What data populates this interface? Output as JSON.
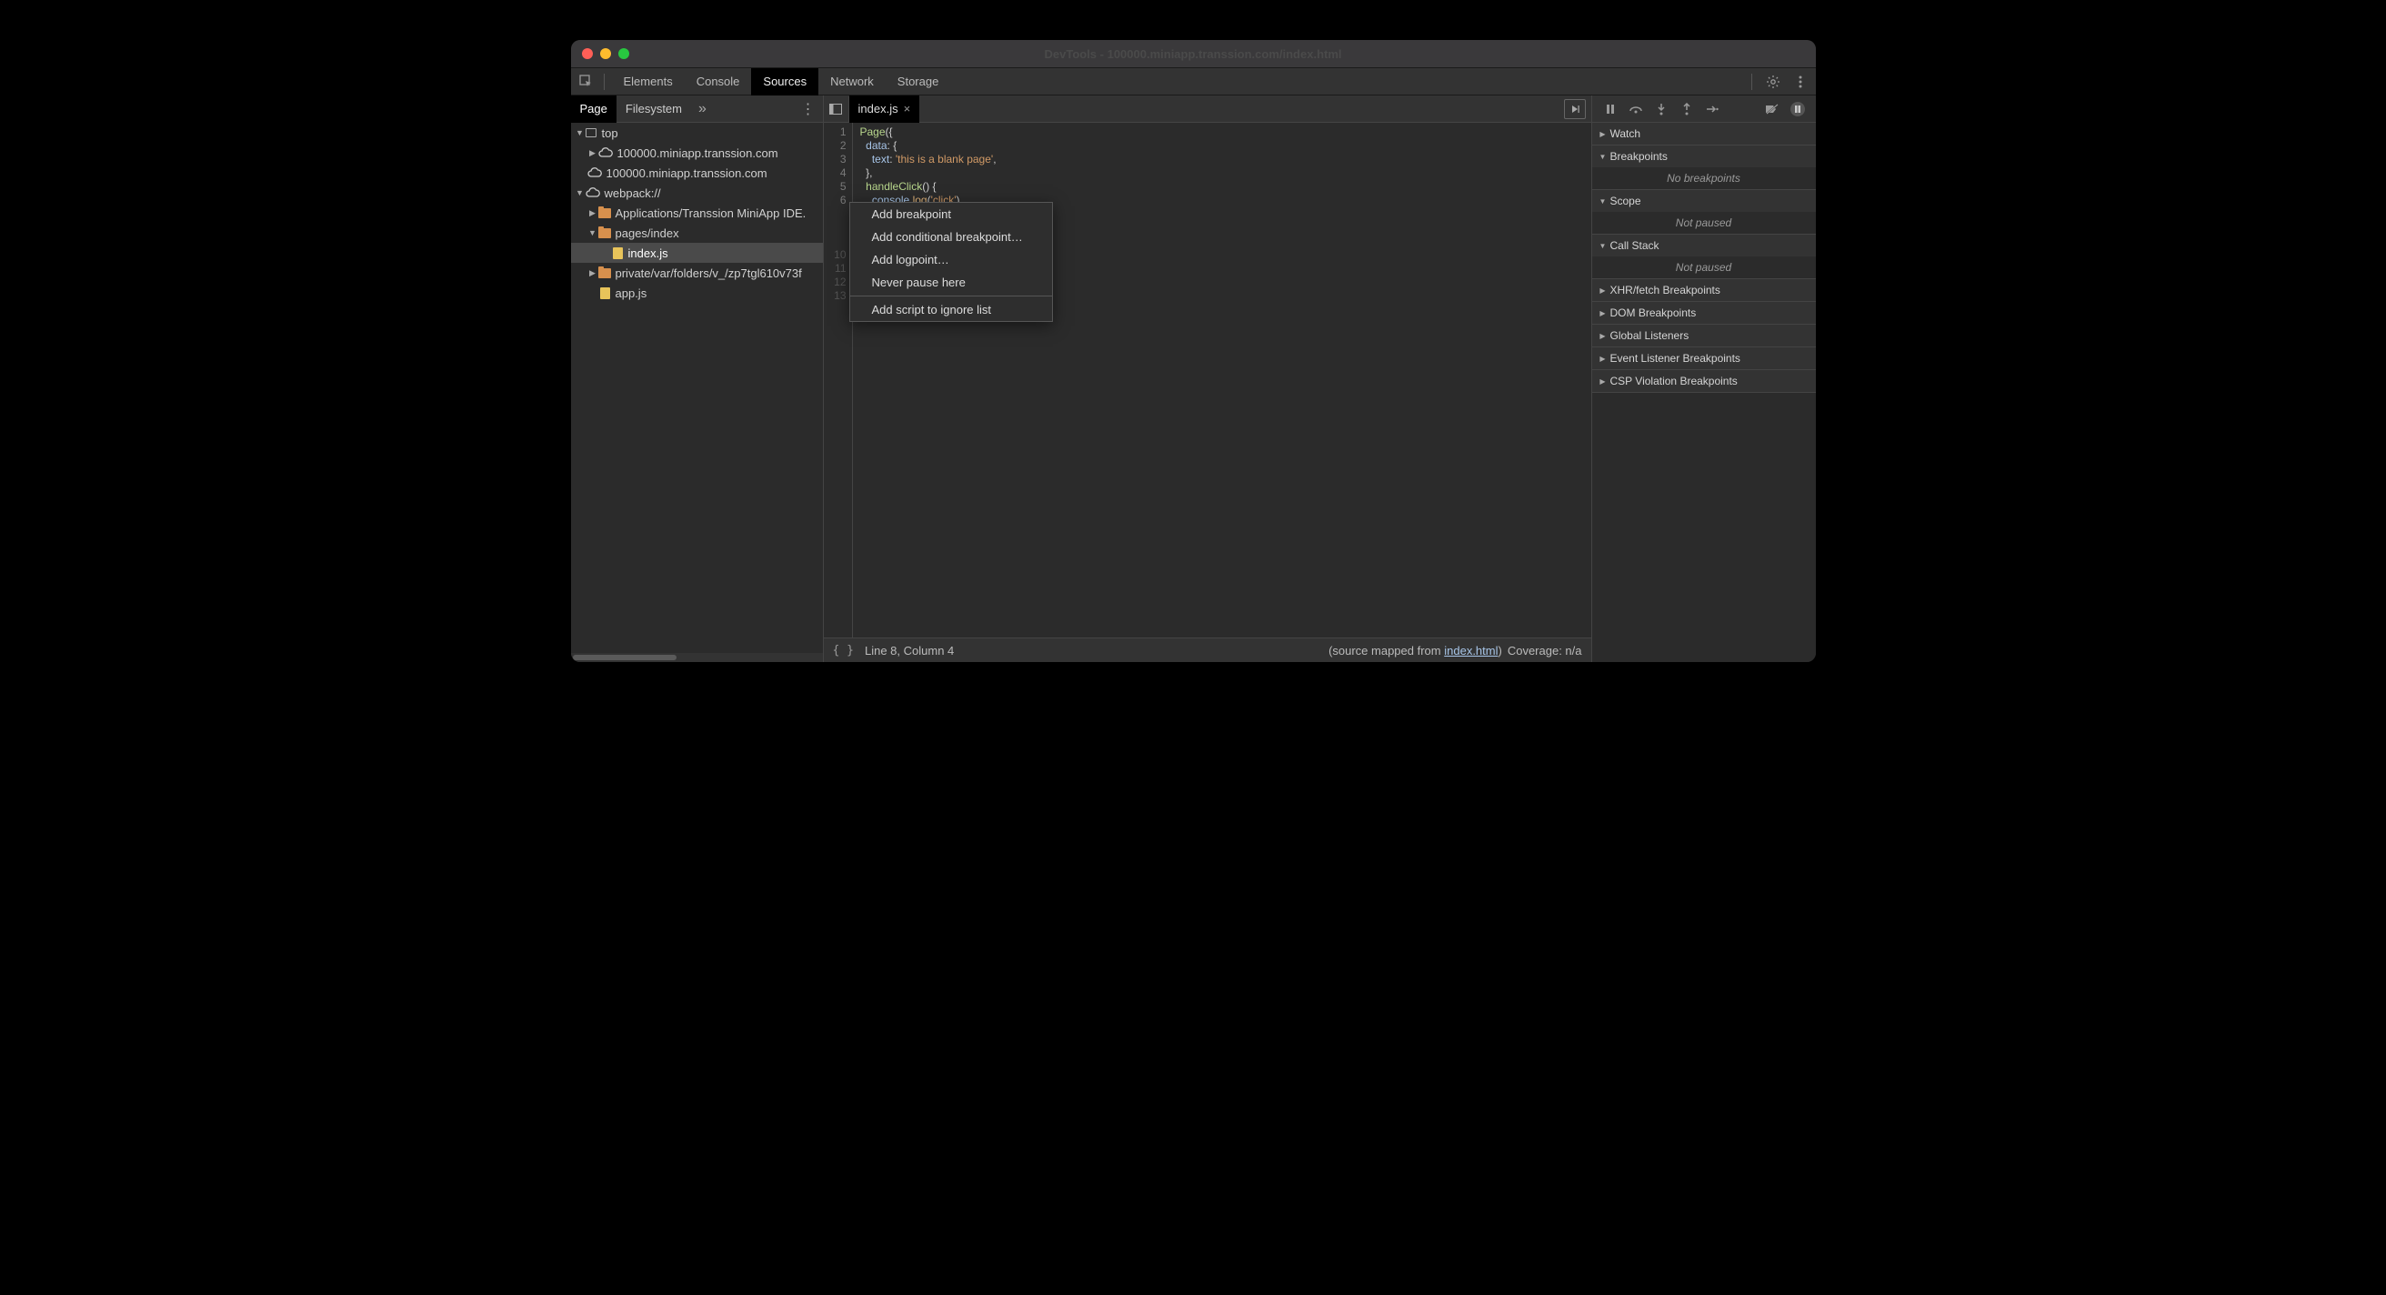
{
  "window_title": "DevTools - 100000.miniapp.transsion.com/index.html",
  "top_tabs": {
    "elements": "Elements",
    "console": "Console",
    "sources": "Sources",
    "network": "Network",
    "storage": "Storage"
  },
  "navigator": {
    "tabs": {
      "page": "Page",
      "filesystem": "Filesystem"
    },
    "tree": {
      "top": "top",
      "domain1": "100000.miniapp.transsion.com",
      "domain2": "100000.miniapp.transsion.com",
      "webpack": "webpack://",
      "apps": "Applications/Transsion MiniApp IDE.",
      "pages_index": "pages/index",
      "index_js": "index.js",
      "private": "private/var/folders/v_/zp7tgl610v73f",
      "app_js": "app.js"
    }
  },
  "editor": {
    "tab_name": "index.js",
    "lines": [
      "1",
      "2",
      "3",
      "4",
      "5",
      "6"
    ],
    "hidden_lines": [
      "10",
      "11",
      "12",
      "13"
    ],
    "code": {
      "l1_a": "Page",
      "l1_b": "({",
      "l2_a": "data",
      "l2_b": ": {",
      "l3_a": "text",
      "l3_b": ": ",
      "l3_c": "'this is a blank page'",
      "l3_d": ",",
      "l4": "},",
      "l5_a": "handleClick",
      "l5_b": "() {",
      "l6_a": "console",
      "l6_b": ".",
      "l6_c": "log",
      "l6_d": "(",
      "l6_e": "'click'",
      "l6_f": ")"
    }
  },
  "context_menu": {
    "add_bp": "Add breakpoint",
    "add_cond": "Add conditional breakpoint…",
    "add_log": "Add logpoint…",
    "never": "Never pause here",
    "ignore": "Add script to ignore list"
  },
  "status": {
    "line_col": "Line 8, Column 4",
    "source_prefix": "(source mapped from ",
    "source_link": "index.html",
    "source_suffix": ")",
    "coverage": "Coverage: n/a"
  },
  "sidebar": {
    "watch": "Watch",
    "breakpoints": "Breakpoints",
    "no_bp": "No breakpoints",
    "scope": "Scope",
    "not_paused": "Not paused",
    "callstack": "Call Stack",
    "xhr": "XHR/fetch Breakpoints",
    "dom": "DOM Breakpoints",
    "global": "Global Listeners",
    "event": "Event Listener Breakpoints",
    "csp": "CSP Violation Breakpoints"
  }
}
